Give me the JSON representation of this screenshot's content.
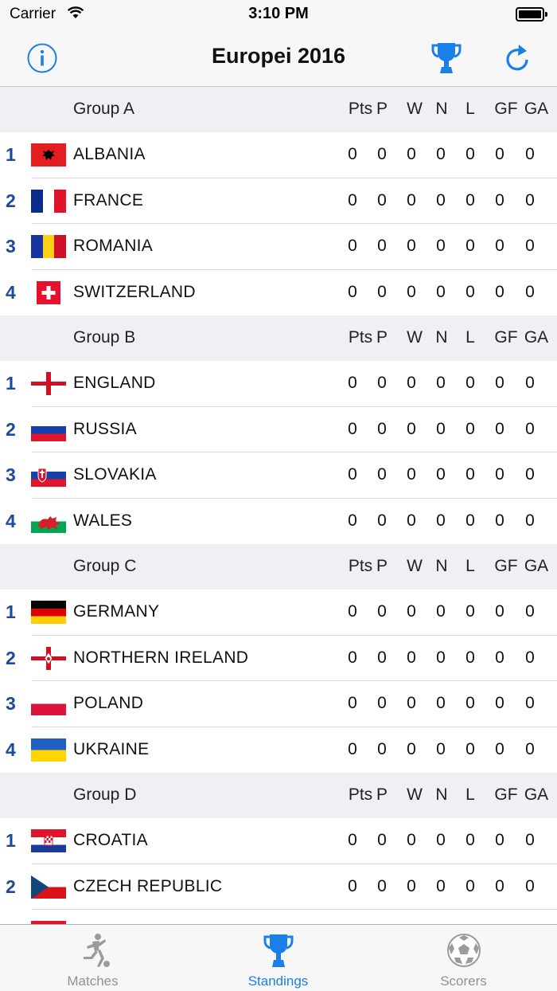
{
  "status_bar": {
    "carrier": "Carrier",
    "time": "3:10 PM"
  },
  "nav": {
    "title": "Europei 2016"
  },
  "columns": [
    "Pts",
    "P",
    "W",
    "N",
    "L",
    "GF",
    "GA"
  ],
  "groups": [
    {
      "name": "Group A",
      "teams": [
        {
          "pos": "1",
          "name": "ALBANIA",
          "flag": "albania",
          "stats": [
            "0",
            "0",
            "0",
            "0",
            "0",
            "0",
            "0"
          ]
        },
        {
          "pos": "2",
          "name": "FRANCE",
          "flag": "france",
          "stats": [
            "0",
            "0",
            "0",
            "0",
            "0",
            "0",
            "0"
          ]
        },
        {
          "pos": "3",
          "name": "ROMANIA",
          "flag": "romania",
          "stats": [
            "0",
            "0",
            "0",
            "0",
            "0",
            "0",
            "0"
          ]
        },
        {
          "pos": "4",
          "name": "SWITZERLAND",
          "flag": "switzerland",
          "stats": [
            "0",
            "0",
            "0",
            "0",
            "0",
            "0",
            "0"
          ]
        }
      ]
    },
    {
      "name": "Group B",
      "teams": [
        {
          "pos": "1",
          "name": "ENGLAND",
          "flag": "england",
          "stats": [
            "0",
            "0",
            "0",
            "0",
            "0",
            "0",
            "0"
          ]
        },
        {
          "pos": "2",
          "name": "RUSSIA",
          "flag": "russia",
          "stats": [
            "0",
            "0",
            "0",
            "0",
            "0",
            "0",
            "0"
          ]
        },
        {
          "pos": "3",
          "name": "SLOVAKIA",
          "flag": "slovakia",
          "stats": [
            "0",
            "0",
            "0",
            "0",
            "0",
            "0",
            "0"
          ]
        },
        {
          "pos": "4",
          "name": "WALES",
          "flag": "wales",
          "stats": [
            "0",
            "0",
            "0",
            "0",
            "0",
            "0",
            "0"
          ]
        }
      ]
    },
    {
      "name": "Group C",
      "teams": [
        {
          "pos": "1",
          "name": "GERMANY",
          "flag": "germany",
          "stats": [
            "0",
            "0",
            "0",
            "0",
            "0",
            "0",
            "0"
          ]
        },
        {
          "pos": "2",
          "name": "NORTHERN IRELAND",
          "flag": "northern-ireland",
          "stats": [
            "0",
            "0",
            "0",
            "0",
            "0",
            "0",
            "0"
          ]
        },
        {
          "pos": "3",
          "name": "POLAND",
          "flag": "poland",
          "stats": [
            "0",
            "0",
            "0",
            "0",
            "0",
            "0",
            "0"
          ]
        },
        {
          "pos": "4",
          "name": "UKRAINE",
          "flag": "ukraine",
          "stats": [
            "0",
            "0",
            "0",
            "0",
            "0",
            "0",
            "0"
          ]
        }
      ]
    },
    {
      "name": "Group D",
      "teams": [
        {
          "pos": "1",
          "name": "CROATIA",
          "flag": "croatia",
          "stats": [
            "0",
            "0",
            "0",
            "0",
            "0",
            "0",
            "0"
          ]
        },
        {
          "pos": "2",
          "name": "CZECH REPUBLIC",
          "flag": "czech-republic",
          "stats": [
            "0",
            "0",
            "0",
            "0",
            "0",
            "0",
            "0"
          ]
        },
        {
          "pos": "",
          "name": "",
          "flag": "spain-partial",
          "stats": [
            "",
            "",
            "",
            "",
            "",
            "",
            ""
          ]
        }
      ]
    }
  ],
  "tabs": [
    {
      "label": "Matches",
      "icon": "soccer-player-icon",
      "active": false
    },
    {
      "label": "Standings",
      "icon": "trophy-icon",
      "active": true
    },
    {
      "label": "Scorers",
      "icon": "soccer-ball-icon",
      "active": false
    }
  ],
  "colors": {
    "accent": "#1a7fe8",
    "position": "#1d4a9c",
    "header_bg": "#efeff4"
  }
}
